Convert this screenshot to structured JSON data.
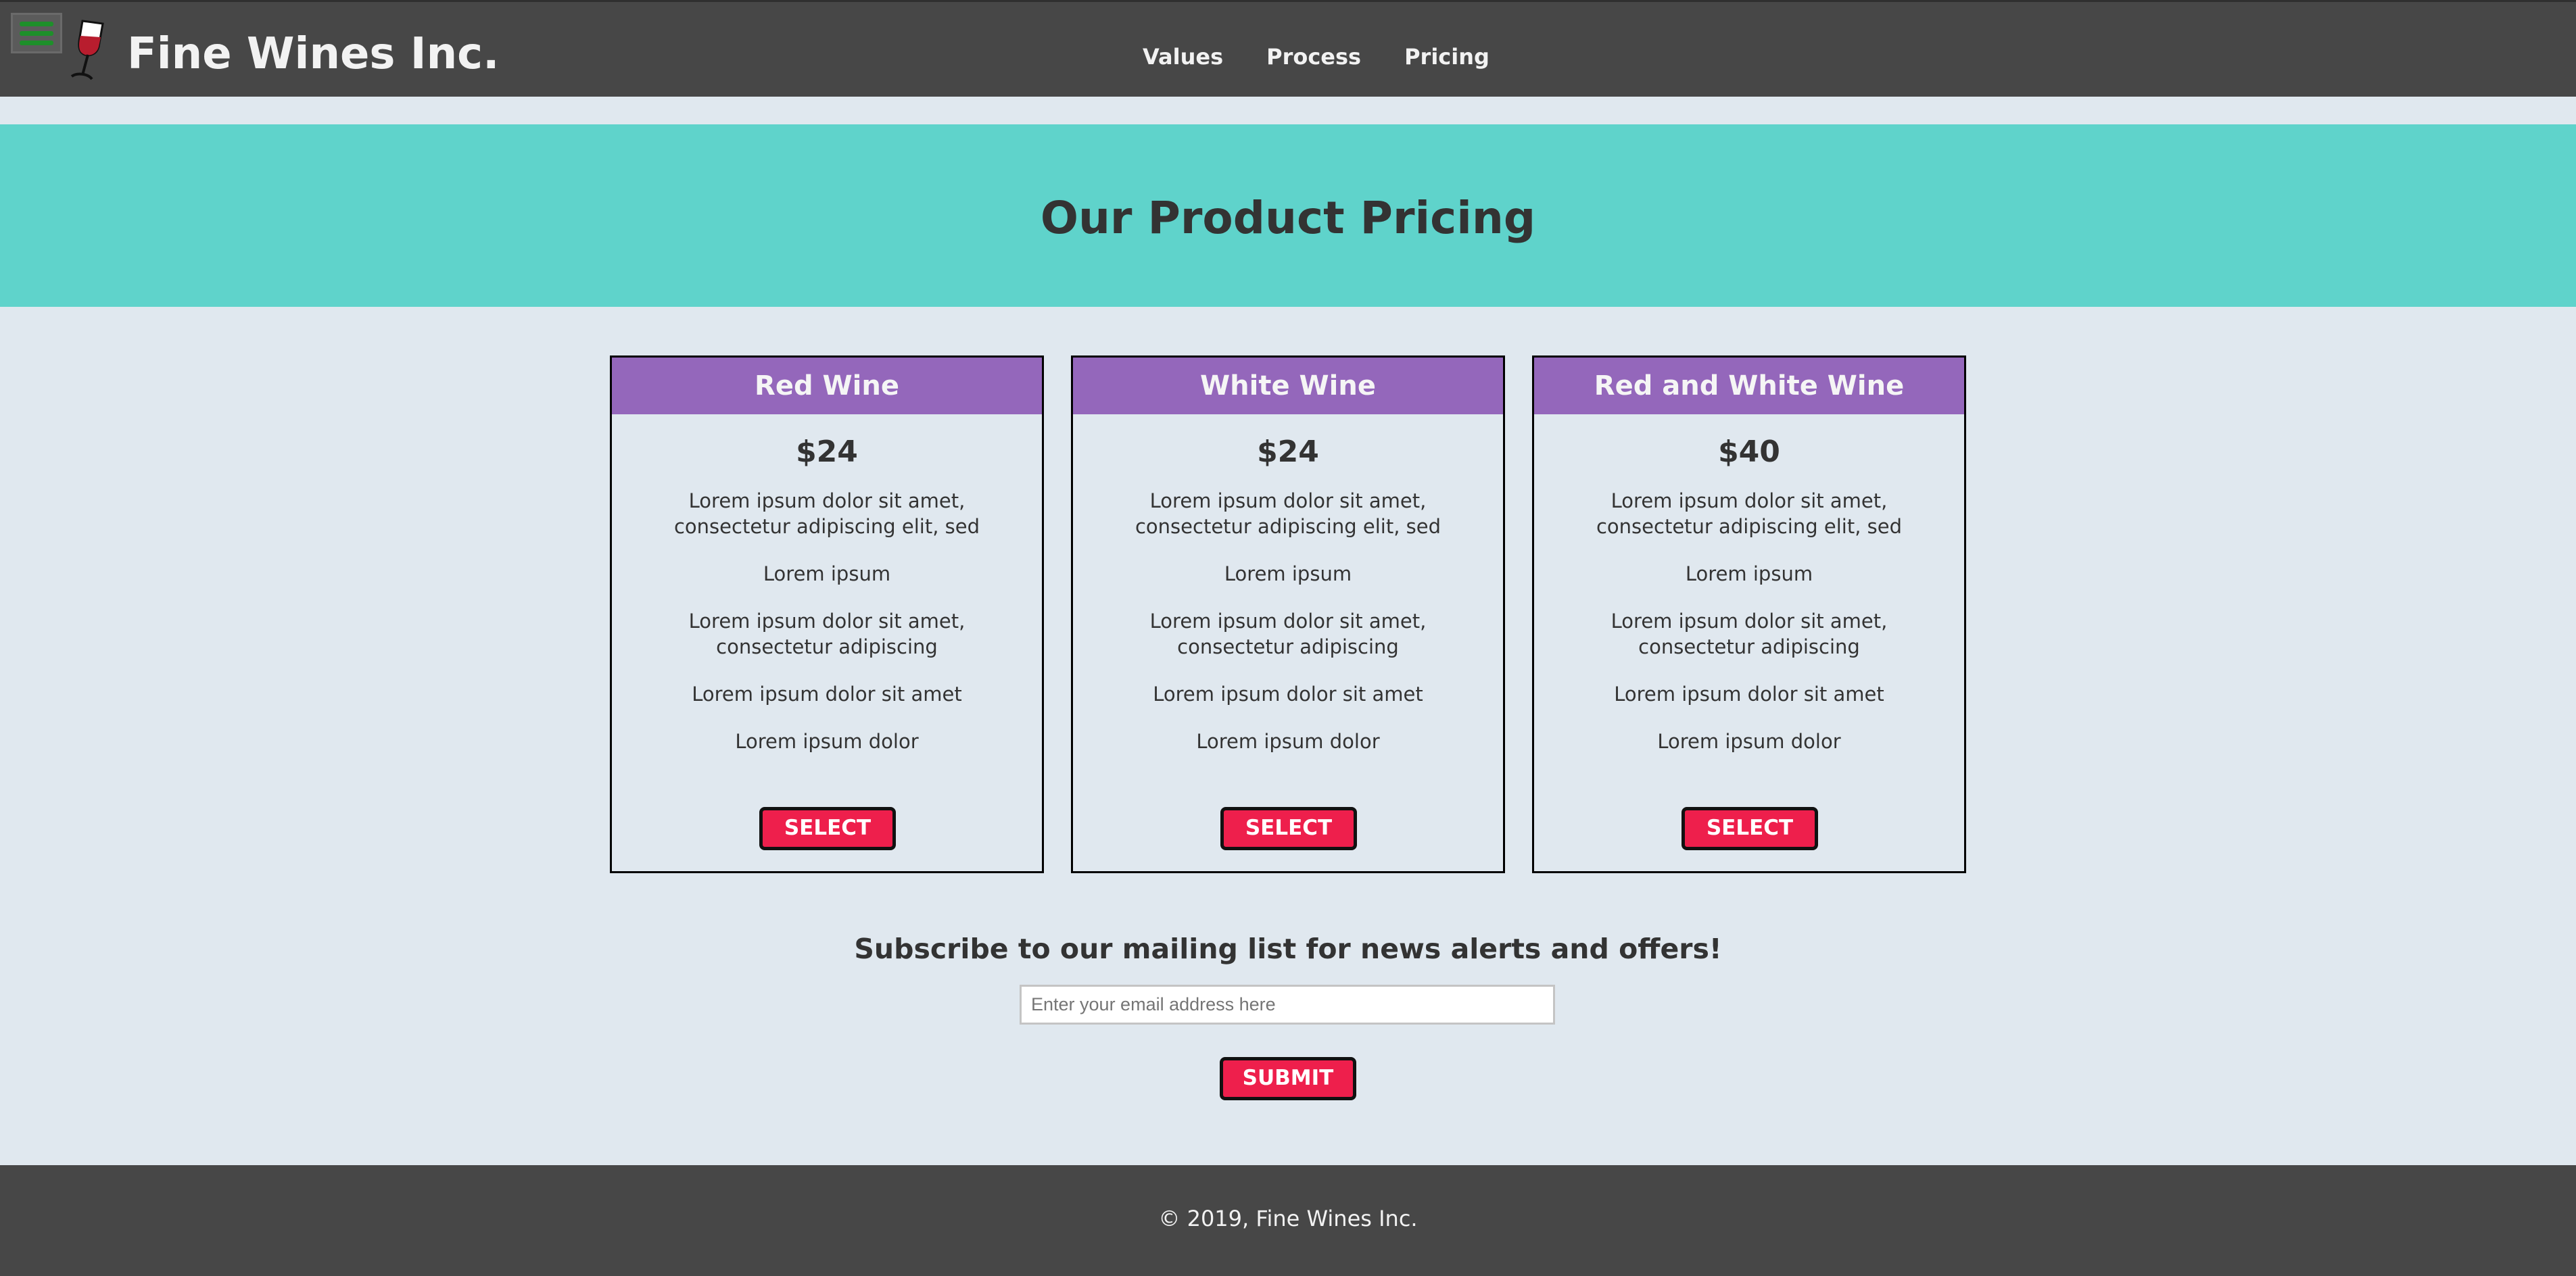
{
  "header": {
    "title": "Fine Wines Inc.",
    "menu_icon": "hamburger-menu-icon",
    "logo_icon": "wine-glass-icon",
    "nav": [
      {
        "label": "Values"
      },
      {
        "label": "Process"
      },
      {
        "label": "Pricing"
      }
    ]
  },
  "hero": {
    "title": "Our Product Pricing"
  },
  "pricing": {
    "cards": [
      {
        "name": "Red Wine",
        "price": "$24",
        "features": [
          "Lorem ipsum dolor sit amet, consectetur adipiscing elit, sed",
          "Lorem ipsum",
          "Lorem ipsum dolor sit amet, consectetur adipiscing",
          "Lorem ipsum dolor sit amet",
          "Lorem ipsum dolor"
        ],
        "button": "SELECT"
      },
      {
        "name": "White Wine",
        "price": "$24",
        "features": [
          "Lorem ipsum dolor sit amet, consectetur adipiscing elit, sed",
          "Lorem ipsum",
          "Lorem ipsum dolor sit amet, consectetur adipiscing",
          "Lorem ipsum dolor sit amet",
          "Lorem ipsum dolor"
        ],
        "button": "SELECT"
      },
      {
        "name": "Red and White Wine",
        "price": "$40",
        "features": [
          "Lorem ipsum dolor sit amet, consectetur adipiscing elit, sed",
          "Lorem ipsum",
          "Lorem ipsum dolor sit amet, consectetur adipiscing",
          "Lorem ipsum dolor sit amet",
          "Lorem ipsum dolor"
        ],
        "button": "SELECT"
      }
    ]
  },
  "subscribe": {
    "title": "Subscribe to our mailing list for news alerts and offers!",
    "email_placeholder": "Enter your email address here",
    "email_value": "",
    "submit_label": "SUBMIT"
  },
  "footer": {
    "text": "© 2019, Fine Wines Inc."
  },
  "colors": {
    "header_bg": "#474747",
    "hero_bg": "#5fd3cb",
    "page_bg": "#e0e8ef",
    "card_header_bg": "#9467bb",
    "button_bg": "#ee1f4c",
    "menu_icon_green": "#1e8f2a",
    "wine_red": "#b81d2e"
  }
}
